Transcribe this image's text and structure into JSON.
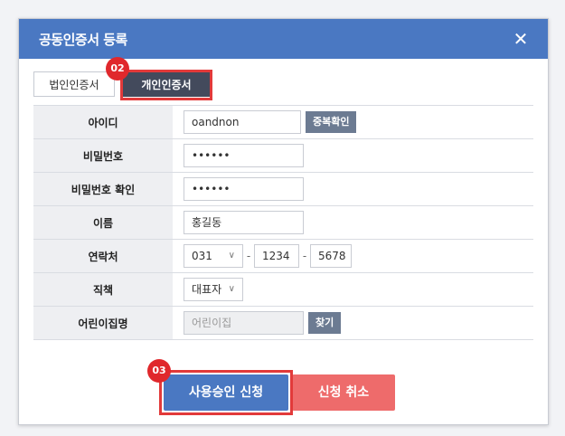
{
  "dialog": {
    "title": "공동인증서 등록",
    "close_symbol": "✕"
  },
  "tabs": {
    "corporate": "법인인증서",
    "personal": "개인인증서"
  },
  "markers": {
    "tab": "02",
    "apply": "03"
  },
  "form": {
    "id": {
      "label": "아이디",
      "value": "oandnon",
      "button": "중복확인"
    },
    "password": {
      "label": "비밀번호",
      "value": "••••••"
    },
    "password_confirm": {
      "label": "비밀번호 확인",
      "value": "••••••"
    },
    "name": {
      "label": "이름",
      "value": "홍길동"
    },
    "contact": {
      "label": "연락처",
      "area": "031",
      "middle": "1234",
      "last": "5678",
      "dash": "-"
    },
    "position": {
      "label": "직책",
      "value": "대표자"
    },
    "kindergarten": {
      "label": "어린이집명",
      "placeholder": "어린이집",
      "button": "찾기"
    }
  },
  "buttons": {
    "apply": "사용승인 신청",
    "cancel": "신청 취소"
  },
  "colors": {
    "header": "#4a78c2",
    "apply": "#4a78c2",
    "cancel": "#ee6b6b",
    "marker": "#e0282c"
  }
}
